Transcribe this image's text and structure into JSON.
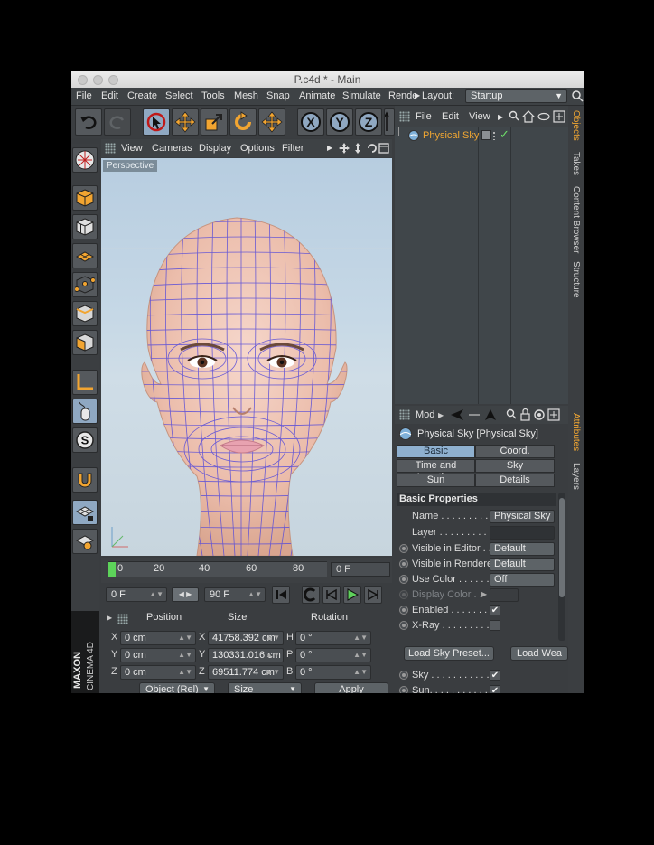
{
  "window": {
    "title": "P.c4d * - Main"
  },
  "menu": [
    "File",
    "Edit",
    "Create",
    "Select",
    "Tools",
    "Mesh",
    "Snap",
    "Animate",
    "Simulate",
    "Rende"
  ],
  "layout": {
    "label": "Layout:",
    "value": "Startup"
  },
  "axis_buttons": [
    "X",
    "Y",
    "Z"
  ],
  "viewport": {
    "menu": [
      "View",
      "Cameras",
      "Display",
      "Options",
      "Filter"
    ],
    "label": "Perspective"
  },
  "timeline": {
    "ticks": [
      "0",
      "20",
      "40",
      "60",
      "80"
    ],
    "frame_field": "0 F"
  },
  "animation": {
    "start": "0 F",
    "end": "90 F"
  },
  "coordinates": {
    "headers": {
      "position": "Position",
      "size": "Size",
      "rotation": "Rotation"
    },
    "rows": [
      {
        "axis": "X",
        "pos": "0 cm",
        "size_axis": "X",
        "size": "41758.392 cm",
        "rot_axis": "H",
        "rot": "0 °"
      },
      {
        "axis": "Y",
        "pos": "0 cm",
        "size_axis": "Y",
        "size": "130331.016 cm",
        "rot_axis": "P",
        "rot": "0 °"
      },
      {
        "axis": "Z",
        "pos": "0 cm",
        "size_axis": "Z",
        "size": "69511.774 cm",
        "rot_axis": "B",
        "rot": "0 °"
      }
    ],
    "mode": "Object (Rel)",
    "size_mode": "Size",
    "apply": "Apply"
  },
  "brand": {
    "maxon": "MAXON",
    "product": "CINEMA 4D"
  },
  "objects": {
    "menu": [
      "File",
      "Edit",
      "View"
    ],
    "items": [
      {
        "name": "Physical Sky"
      }
    ]
  },
  "side_tabs_top": [
    "Objects",
    "Takes",
    "Content Browser",
    "Structure"
  ],
  "side_tabs_bottom": [
    "Attributes",
    "Layers"
  ],
  "attributes": {
    "menu": [
      "Mod"
    ],
    "object_title": "Physical Sky [Physical Sky]",
    "tabs": [
      {
        "label": "Basic",
        "active": true
      },
      {
        "label": "Coord.",
        "active": false
      },
      {
        "label": "Time and Location",
        "active": false
      },
      {
        "label": "Sky",
        "active": false
      },
      {
        "label": "Sun",
        "active": false
      },
      {
        "label": "Details",
        "active": false
      }
    ],
    "section": "Basic Properties",
    "props": [
      {
        "label": "Name . . . . . . . . . .",
        "value": "Physical Sky",
        "kind": "text",
        "radio": false
      },
      {
        "label": "Layer . . . . . . . . . .",
        "value": "",
        "kind": "text",
        "radio": false
      },
      {
        "label": "Visible in Editor  . .",
        "value": "Default",
        "kind": "select",
        "radio": true
      },
      {
        "label": "Visible in Renderer",
        "value": "Default",
        "kind": "select",
        "radio": true
      },
      {
        "label": "Use Color . . . . . . .",
        "value": "Off",
        "kind": "select",
        "radio": true
      },
      {
        "label": "Display Color . .",
        "value": "",
        "kind": "color",
        "radio": true,
        "disabled": true
      },
      {
        "label": "Enabled . . . . . . . .",
        "value": "✔",
        "kind": "check",
        "radio": true
      },
      {
        "label": "X-Ray . . . . . . . . .",
        "value": "",
        "kind": "check",
        "radio": true
      }
    ],
    "buttons": [
      "Load Sky Preset...",
      "Load Wea"
    ],
    "more": [
      {
        "label": "Sky . . . . . . . . . . . . .",
        "value": "✔"
      },
      {
        "label": "Sun. . . . . . . . . . . . .",
        "value": "✔"
      }
    ]
  },
  "colors": {
    "accent": "#f0a632",
    "selected_tool": "#8fa8c2",
    "wire": "#5b4fd8"
  }
}
